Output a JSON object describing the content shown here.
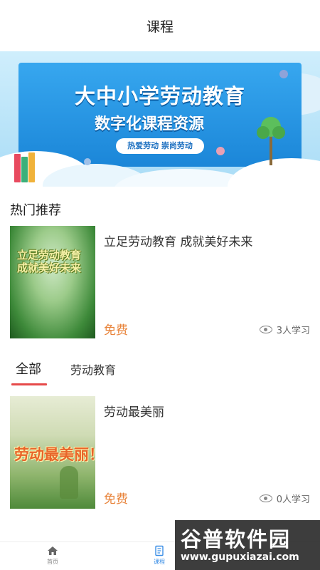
{
  "header": {
    "title": "课程"
  },
  "banner": {
    "title": "大中小学劳动教育",
    "subtitle": "数字化课程资源",
    "slogan": "热爱劳动 崇尚劳动"
  },
  "section": {
    "hot_title": "热门推荐"
  },
  "hot_courses": [
    {
      "thumb_line1": "立足劳动教育",
      "thumb_line2": "成就美好未来",
      "title": "立足劳动教育 成就美好未来",
      "price": "免费",
      "learners": "3人学习"
    }
  ],
  "tabs": [
    {
      "label": "全部",
      "active": true
    },
    {
      "label": "劳动教育",
      "active": false
    }
  ],
  "courses": [
    {
      "thumb_text": "劳动最美丽！",
      "title": "劳动最美丽",
      "price": "免费",
      "learners": "0人学习"
    }
  ],
  "bottom_nav": [
    {
      "label": "首页",
      "icon": "home-icon",
      "active": false
    },
    {
      "label": "课程",
      "icon": "book-icon",
      "active": true
    }
  ],
  "watermark": {
    "main": "谷普软件园",
    "url": "www.gupuxiazai.com"
  },
  "colors": {
    "price": "#e8833a",
    "tab_underline": "#e64a4a",
    "nav_active": "#3a8ee6"
  }
}
